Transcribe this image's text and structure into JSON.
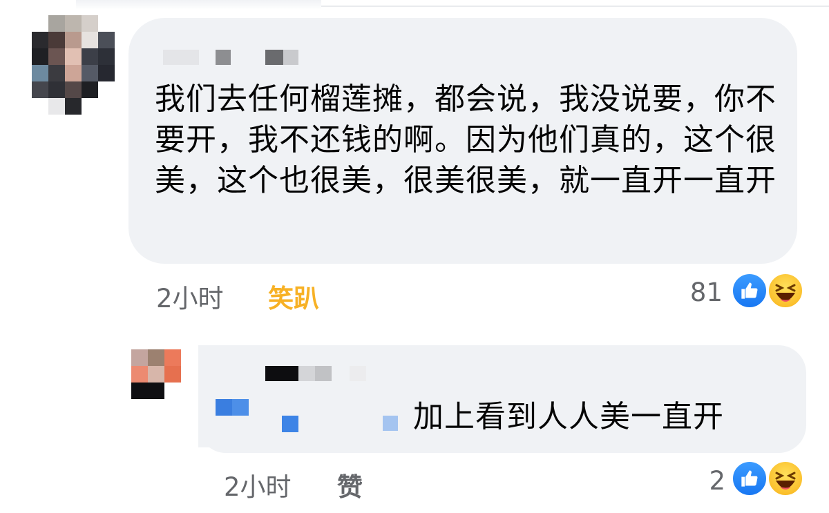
{
  "comment": {
    "text": "我们去任何榴莲摊，都会说，我没说要，你不要开，我不还钱的啊。因为他们真的，这个很美，这个也很美，很美很美，就一直开一直开",
    "time": "2小时",
    "reaction_label": "笑趴",
    "reaction_color": "#f7b125",
    "reaction_count": "81",
    "reactions": [
      "like-icon",
      "haha-icon"
    ]
  },
  "reply": {
    "text": "加上看到人人美一直开",
    "time": "2小时",
    "reaction_label": "赞",
    "reaction_count": "2",
    "reactions": [
      "like-icon",
      "haha-icon"
    ]
  },
  "colors": {
    "bubble": "#f0f2f5",
    "meta": "#65676b",
    "like": "#1877f2",
    "haha": "#fbc02d"
  }
}
